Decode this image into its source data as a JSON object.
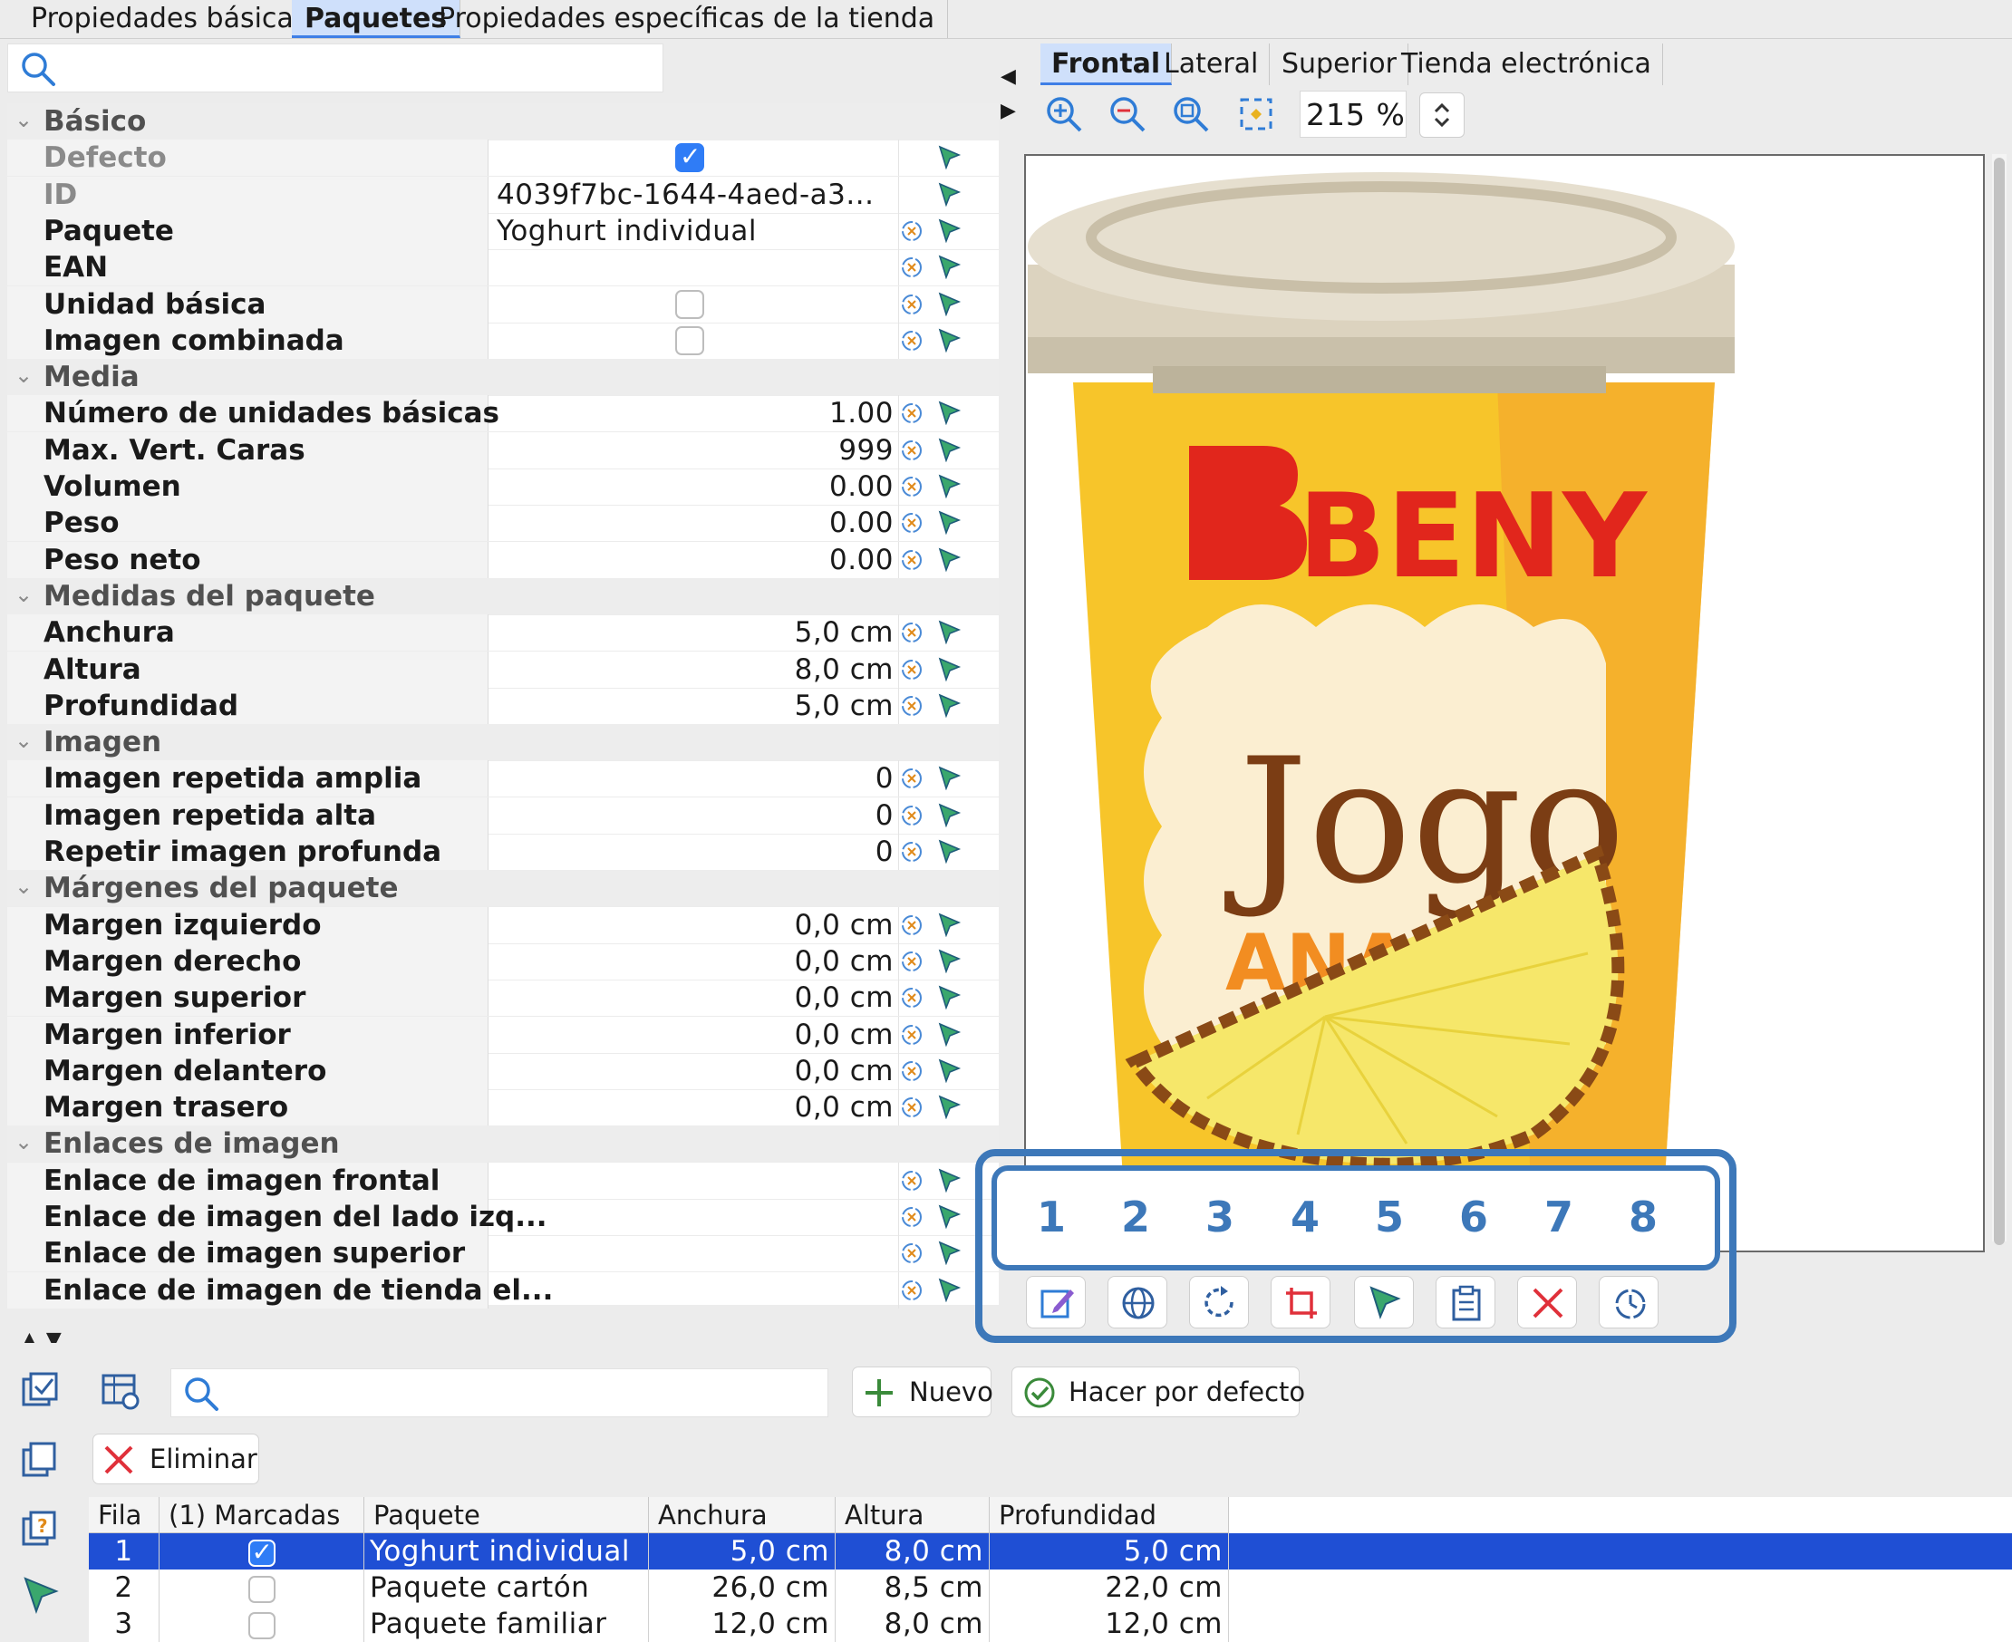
{
  "top_tabs": [
    "Propiedades básicas",
    "Paquetes",
    "Propiedades específicas de la tienda"
  ],
  "left_search": {
    "placeholder": ""
  },
  "properties": {
    "basico": {
      "label": "Básico",
      "rows": [
        {
          "name": "Defecto",
          "type": "checkbox",
          "checked": true,
          "disabled": true
        },
        {
          "name": "ID",
          "value": "4039f7bc-1644-4aed-a3...",
          "disabled": true
        },
        {
          "name": "Paquete",
          "value": "Yoghurt individual"
        },
        {
          "name": "EAN",
          "value": ""
        },
        {
          "name": "Unidad básica",
          "type": "checkbox",
          "checked": false
        },
        {
          "name": "Imagen combinada",
          "type": "checkbox",
          "checked": false
        }
      ]
    },
    "media": {
      "label": "Media",
      "rows": [
        {
          "name": "Número de unidades básicas",
          "value": "1.00"
        },
        {
          "name": "Max. Vert. Caras",
          "value": "999"
        },
        {
          "name": "Volumen",
          "value": "0.00"
        },
        {
          "name": "Peso",
          "value": "0.00"
        },
        {
          "name": "Peso neto",
          "value": "0.00"
        }
      ]
    },
    "medidas": {
      "label": "Medidas del paquete",
      "rows": [
        {
          "name": "Anchura",
          "value": "5,0 cm"
        },
        {
          "name": "Altura",
          "value": "8,0 cm"
        },
        {
          "name": "Profundidad",
          "value": "5,0 cm"
        }
      ]
    },
    "imagen": {
      "label": "Imagen",
      "rows": [
        {
          "name": "Imagen repetida amplia",
          "value": "0"
        },
        {
          "name": "Imagen repetida alta",
          "value": "0"
        },
        {
          "name": "Repetir imagen profunda",
          "value": "0"
        }
      ]
    },
    "margenes": {
      "label": "Márgenes del paquete",
      "rows": [
        {
          "name": "Margen izquierdo",
          "value": "0,0 cm"
        },
        {
          "name": "Margen derecho",
          "value": "0,0 cm"
        },
        {
          "name": "Margen superior",
          "value": "0,0 cm"
        },
        {
          "name": "Margen inferior",
          "value": "0,0 cm"
        },
        {
          "name": "Margen delantero",
          "value": "0,0 cm"
        },
        {
          "name": "Margen trasero",
          "value": "0,0 cm"
        }
      ]
    },
    "enlaces": {
      "label": "Enlaces de imagen",
      "rows": [
        {
          "name": "Enlace de imagen frontal",
          "value": ""
        },
        {
          "name": "Enlace de imagen del lado izq...",
          "value": ""
        },
        {
          "name": "Enlace de imagen superior",
          "value": ""
        },
        {
          "name": "Enlace de imagen de tienda el...",
          "value": ""
        }
      ]
    }
  },
  "image_tabs": [
    "Frontal",
    "Lateral",
    "Superior",
    "Tienda electrónica"
  ],
  "zoom": {
    "value": "215 %",
    "icons": [
      "zoom-in-icon",
      "zoom-out-icon",
      "zoom-fit-icon",
      "zoom-selection-icon"
    ]
  },
  "product_image": {
    "brand": "BENY",
    "name": "Jogo",
    "flavor": "ANANAS",
    "colors": {
      "cup": "#f7c52a",
      "lid": "#dcd3bf",
      "brand_red": "#e1261c",
      "label": "#fbeed1",
      "text_brown": "#7b3d14",
      "flavor_orange": "#f28d21"
    }
  },
  "highlight": {
    "numbers": [
      "1",
      "2",
      "3",
      "4",
      "5",
      "6",
      "7",
      "8"
    ],
    "color": "#3d78b9"
  },
  "image_tools": [
    "edit-image-icon",
    "web-image-icon",
    "rotate-icon",
    "crop-icon",
    "flag-icon",
    "clipboard-icon",
    "delete-icon",
    "history-icon"
  ],
  "bottom": {
    "search_placeholder": "",
    "new_label": "Nuevo",
    "default_label": "Hacer por defecto",
    "delete_label": "Eliminar",
    "table": {
      "columns": [
        "Fila",
        "(1) Marcadas",
        "Paquete",
        "Anchura",
        "Altura",
        "Profundidad"
      ],
      "rows": [
        {
          "fila": "1",
          "checked": true,
          "paquete": "Yoghurt individual",
          "anchura": "5,0 cm",
          "altura": "8,0 cm",
          "profundidad": "5,0 cm",
          "selected": true
        },
        {
          "fila": "2",
          "checked": false,
          "paquete": "Paquete cartón",
          "anchura": "26,0 cm",
          "altura": "8,5 cm",
          "profundidad": "22,0 cm"
        },
        {
          "fila": "3",
          "checked": false,
          "paquete": "Paquete familiar",
          "anchura": "12,0 cm",
          "altura": "8,0 cm",
          "profundidad": "12,0 cm"
        }
      ]
    }
  },
  "colors": {
    "selection": "#1f4fd4",
    "active_tab": "#cfe0fb",
    "accent": "#2f7cf6"
  }
}
